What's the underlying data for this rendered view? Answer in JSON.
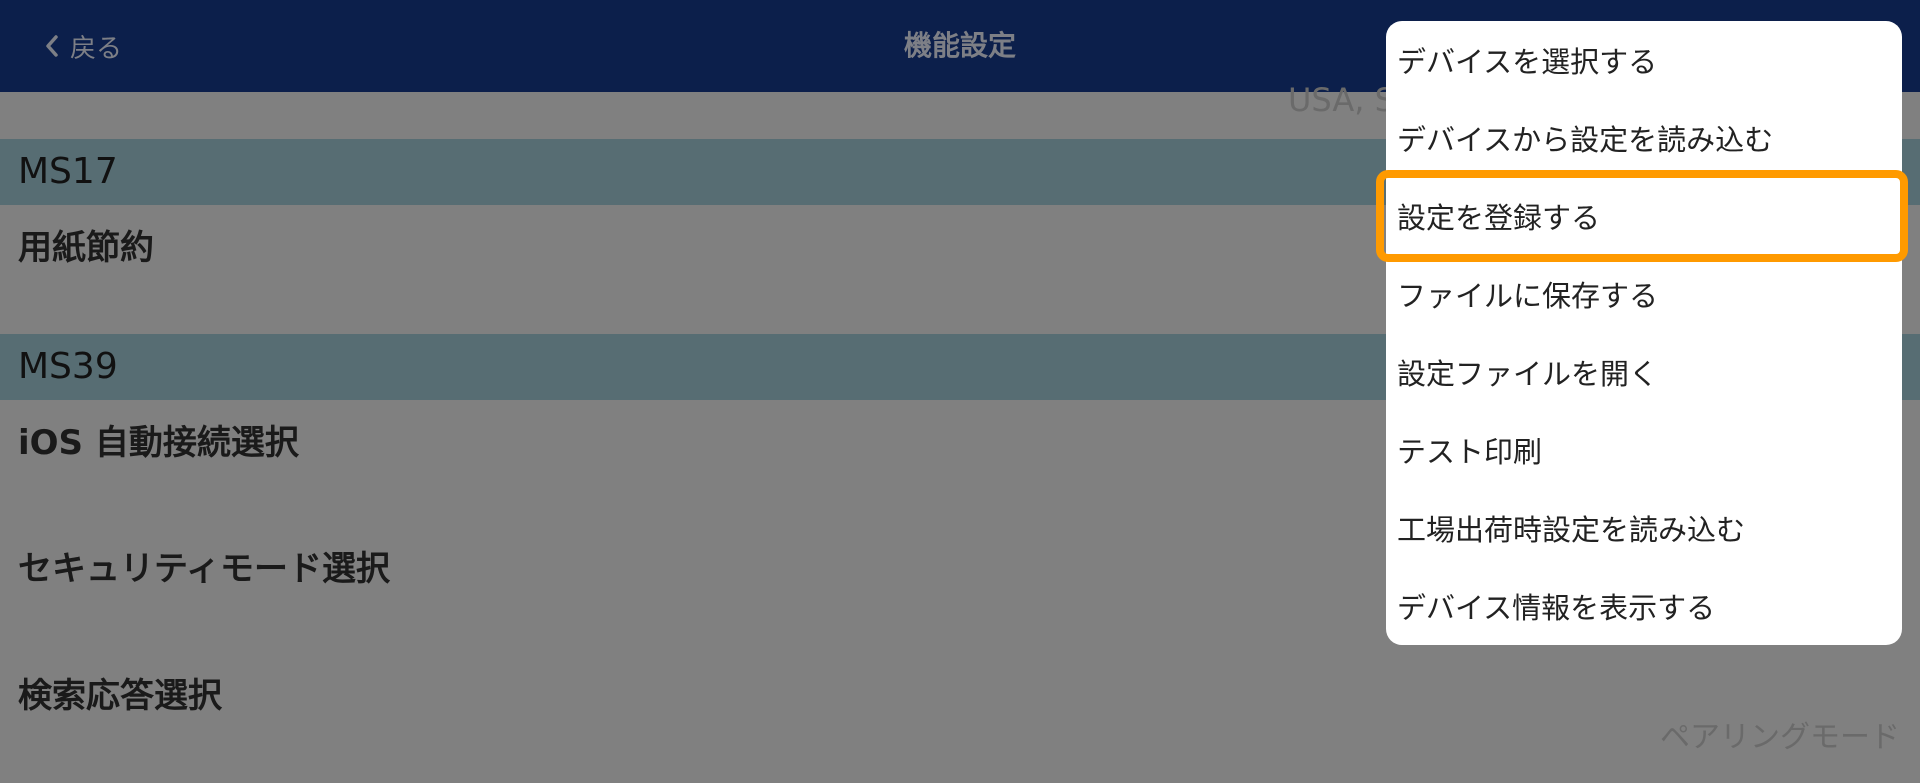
{
  "navbar": {
    "back_label": "戻る",
    "title": "機能設定"
  },
  "content": {
    "top_value": "USA, S",
    "sections": [
      {
        "header": "MS17",
        "rows": [
          "用紙節約"
        ]
      },
      {
        "header": "MS39",
        "rows": [
          "iOS 自動接続選択",
          "セキュリティモード選択",
          "検索応答選択"
        ]
      }
    ],
    "bottom_value": "ペアリングモード"
  },
  "menu": {
    "items": [
      "デバイスを選択する",
      "デバイスから設定を読み込む",
      "設定を登録する",
      "ファイルに保存する",
      "設定ファイルを開く",
      "テスト印刷",
      "工場出荷時設定を読み込む",
      "デバイス情報を表示する"
    ],
    "highlighted_item": "設定を登録する",
    "highlight_color": "#ff9a00"
  },
  "colors": {
    "navbar_bg": "#0c1f4b",
    "section_header_bg": "#576d73",
    "dim_overlay": "#808080"
  }
}
